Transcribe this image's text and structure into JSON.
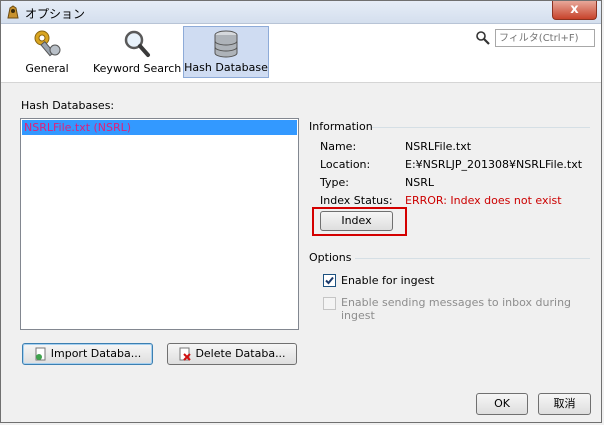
{
  "window": {
    "title": "オプション",
    "close_label": "x"
  },
  "toolbar": {
    "tabs": [
      {
        "label": "General",
        "icon": "settings-tools-icon"
      },
      {
        "label": "Keyword Search",
        "icon": "magnifier-icon"
      },
      {
        "label": "Hash Database",
        "icon": "database-icon",
        "selected": true
      }
    ],
    "filter_placeholder": "フィルタ(Ctrl+F)"
  },
  "hash_databases": {
    "label": "Hash Databases:",
    "items": [
      {
        "name": "NSRLFile.txt (NSRL)",
        "selected": true
      }
    ],
    "import_label": "Import Databa...",
    "delete_label": "Delete Databa..."
  },
  "information": {
    "title": "Information",
    "name_key": "Name:",
    "name_val": "NSRLFile.txt",
    "location_key": "Location:",
    "location_val": "E:¥NSRLJP_201308¥NSRLFile.txt",
    "type_key": "Type:",
    "type_val": "NSRL",
    "status_key": "Index Status:",
    "status_val": "ERROR: Index does not exist",
    "index_button": "Index"
  },
  "options": {
    "title": "Options",
    "enable_ingest_label": "Enable for ingest",
    "enable_ingest_checked": true,
    "enable_messages_label": "Enable sending messages to inbox during ingest",
    "enable_messages_checked": false
  },
  "footer": {
    "ok_label": "OK",
    "cancel_label": "取消"
  },
  "colors": {
    "selection": "#3399ff",
    "error": "#cc0000",
    "highlight": "#d40000"
  }
}
